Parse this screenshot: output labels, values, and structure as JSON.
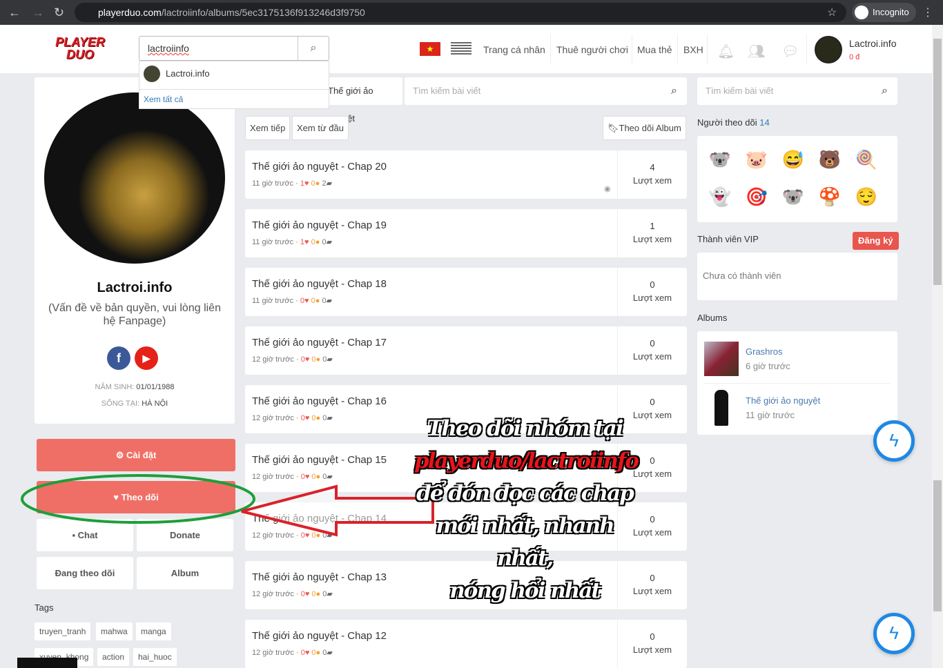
{
  "browser": {
    "url_domain": "playerduo.com",
    "url_path": "/lactroiinfo/albums/5ec3175136f913246d3f9750",
    "incognito_label": "Incognito"
  },
  "header": {
    "logo_text": "PLAYER DUO",
    "search_value": "lactroiinfo",
    "search_dropdown": {
      "result": "Lactroi.info",
      "see_all": "Xem tất cả"
    },
    "menu": [
      "Trang cá nhân",
      "Thuê người chơi",
      "Mua thẻ",
      "BXH"
    ],
    "user": {
      "name": "Lactroi.info",
      "balance": "0 đ"
    }
  },
  "profile": {
    "name": "Lactroi.info",
    "description": "(Vấn đề về bản quyền, vui lòng liên hệ Fanpage)",
    "birth_label": "NĂM SINH:",
    "birth": "01/01/1988",
    "live_label": "SỐNG TẠI:",
    "live": "HÀ NỘI"
  },
  "actions": {
    "settings": "Cài đặt",
    "follow": "Theo dõi",
    "chat": "Chat",
    "donate": "Donate",
    "following": "Đang theo dõi",
    "album": "Album"
  },
  "tags": {
    "title": "Tags",
    "items": [
      "truyen_tranh",
      "mahwa",
      "manga",
      "xuyen_khong",
      "action",
      "hai_huoc"
    ]
  },
  "album": {
    "tab": "Thế giới ảo nguyệt",
    "search_placeholder": "Tìm kiếm bài viết",
    "continue": "Xem tiếp",
    "from_start": "Xem từ đầu",
    "follow_album": "Theo dõi Album",
    "views_label": "Lượt xem",
    "chapters": [
      {
        "title": "Thế giới ảo nguyệt - Chap 20",
        "time": "11 giờ trước",
        "likes": 1,
        "coins": 0,
        "comments": 2,
        "views": 4
      },
      {
        "title": "Thế giới ảo nguyệt - Chap 19",
        "time": "11 giờ trước",
        "likes": 1,
        "coins": 0,
        "comments": 0,
        "views": 1
      },
      {
        "title": "Thế giới ảo nguyệt - Chap 18",
        "time": "11 giờ trước",
        "likes": 0,
        "coins": 0,
        "comments": 0,
        "views": 0
      },
      {
        "title": "Thế giới ảo nguyệt - Chap 17",
        "time": "12 giờ trước",
        "likes": 0,
        "coins": 0,
        "comments": 0,
        "views": 0
      },
      {
        "title": "Thế giới ảo nguyệt - Chap 16",
        "time": "12 giờ trước",
        "likes": 0,
        "coins": 0,
        "comments": 0,
        "views": 0
      },
      {
        "title": "Thế giới ảo nguyệt - Chap 15",
        "time": "12 giờ trước",
        "likes": 0,
        "coins": 0,
        "comments": 0,
        "views": 0
      },
      {
        "title": "Thế giới ảo nguyệt - Chap 14",
        "time": "12 giờ trước",
        "likes": 0,
        "coins": 0,
        "comments": 0,
        "views": 0
      },
      {
        "title": "Thế giới ảo nguyệt - Chap 13",
        "time": "12 giờ trước",
        "likes": 0,
        "coins": 0,
        "comments": 0,
        "views": 0
      },
      {
        "title": "Thế giới ảo nguyệt - Chap 12",
        "time": "12 giờ trước",
        "likes": 0,
        "coins": 0,
        "comments": 0,
        "views": 0
      }
    ]
  },
  "right": {
    "search_placeholder": "Tìm kiếm bài viết",
    "followers_label": "Người theo dõi",
    "followers_count": "14",
    "followers": [
      "🐨",
      "🐷",
      "😅",
      "🐻",
      "🍭",
      "👻",
      "🎯",
      "🐨",
      "🍄",
      "😌"
    ],
    "vip_label": "Thành viên VIP",
    "register": "Đăng ký",
    "vip_empty": "Chưa có thành viên",
    "albums_label": "Albums",
    "albums": [
      {
        "name": "Grashros",
        "time": "6 giờ trước"
      },
      {
        "name": "Thế giới ảo nguyệt",
        "time": "11 giờ trước"
      }
    ]
  },
  "overlay": {
    "lines": [
      "Theo dõi nhóm tại",
      "playerduo/lactroiinfo",
      "để đón đọc các chap",
      "mới nhất, nhanh nhất,",
      "nóng hổi nhất"
    ]
  },
  "colors": {
    "accent": "#ef6f66",
    "link": "#337ab7",
    "annotation_ellipse": "#1e9e3a",
    "annotation_arrow": "#d9222a"
  }
}
